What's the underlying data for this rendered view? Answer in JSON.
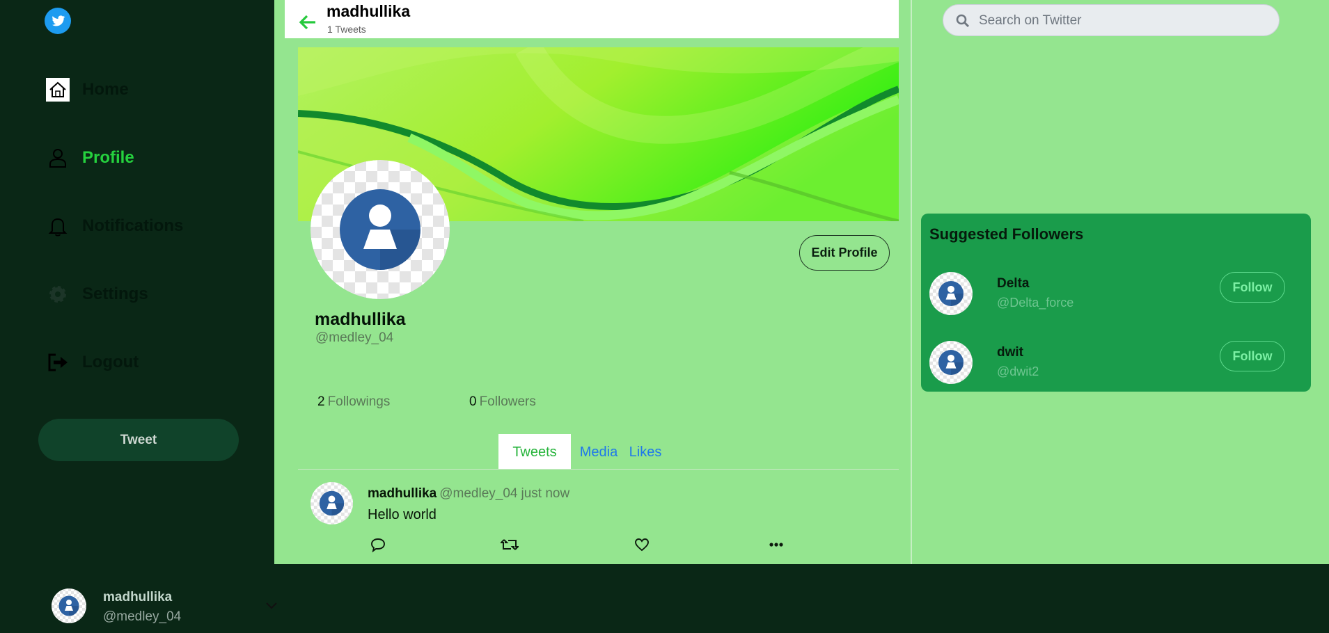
{
  "sidebar": {
    "logo": "twitter-bird-icon",
    "nav": [
      {
        "label": "Home",
        "icon": "home-icon"
      },
      {
        "label": "Profile",
        "icon": "user-icon"
      },
      {
        "label": "Notifications",
        "icon": "bell-icon"
      },
      {
        "label": "Settings",
        "icon": "gear-icon"
      },
      {
        "label": "Logout",
        "icon": "logout-icon"
      }
    ],
    "tweet_button": "Tweet",
    "account": {
      "name": "madhullika",
      "handle": "@medley_04"
    }
  },
  "header": {
    "name": "madhullika",
    "tweet_count": "1 Tweets"
  },
  "profile": {
    "name": "madhullika",
    "handle": "@medley_04",
    "edit_button": "Edit Profile",
    "followings_count": "2",
    "followings_label": "Followings",
    "followers_count": "0",
    "followers_label": "Followers"
  },
  "tabs": [
    {
      "label": "Tweets",
      "active": true
    },
    {
      "label": "Media",
      "active": false
    },
    {
      "label": "Likes",
      "active": false
    }
  ],
  "tweet": {
    "name": "madhullika",
    "handle": "@medley_04",
    "time": "just now",
    "text": "Hello world",
    "actions": [
      "reply-icon",
      "retweet-icon",
      "like-icon",
      "more-icon"
    ]
  },
  "search": {
    "placeholder": "Search on Twitter",
    "value": ""
  },
  "suggestions": {
    "title": "Suggested Followers",
    "users": [
      {
        "name": "Delta",
        "handle": "@Delta_force",
        "button": "Follow"
      },
      {
        "name": "dwit",
        "handle": "@dwit2",
        "button": "Follow"
      }
    ]
  },
  "colors": {
    "sidebar_bg": "#0a2716",
    "main_bg": "#94e58f",
    "accent_green": "#25d23e",
    "suggest_bg": "#1a9c4b",
    "link_blue": "#1f78ea"
  }
}
